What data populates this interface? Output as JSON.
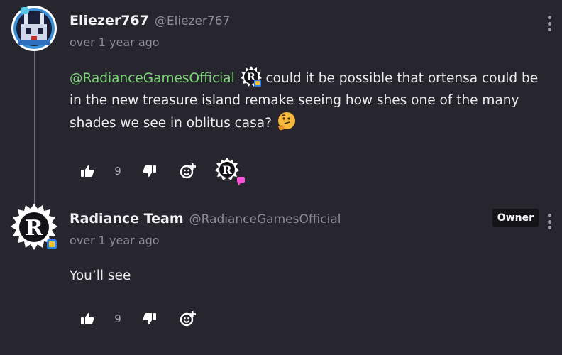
{
  "comments": [
    {
      "display_name": "Eliezer767",
      "handle": "@Eliezer767",
      "timestamp": "over 1 year ago",
      "mention": "@RadianceGamesOfficial",
      "body": "could it be possible that ortensa could be in the new treasure island remake seeing how shes one of the many shades we see in oblitus casa?",
      "like_count": "9",
      "emoji": "thinking-face"
    },
    {
      "display_name": "Radiance Team",
      "handle": "@RadianceGamesOfficial",
      "timestamp": "over 1 year ago",
      "badge": "Owner",
      "body": "You’ll see",
      "like_count": "9"
    }
  ],
  "colors": {
    "background": "#27262e",
    "mention": "#7ed37a",
    "muted_text": "#8e8d96",
    "reply_indicator": "#ff4fd8"
  },
  "icons": [
    "thumbs-up-icon",
    "thumbs-down-icon",
    "add-reaction-icon",
    "more-options-icon",
    "creator-badge-icon"
  ]
}
